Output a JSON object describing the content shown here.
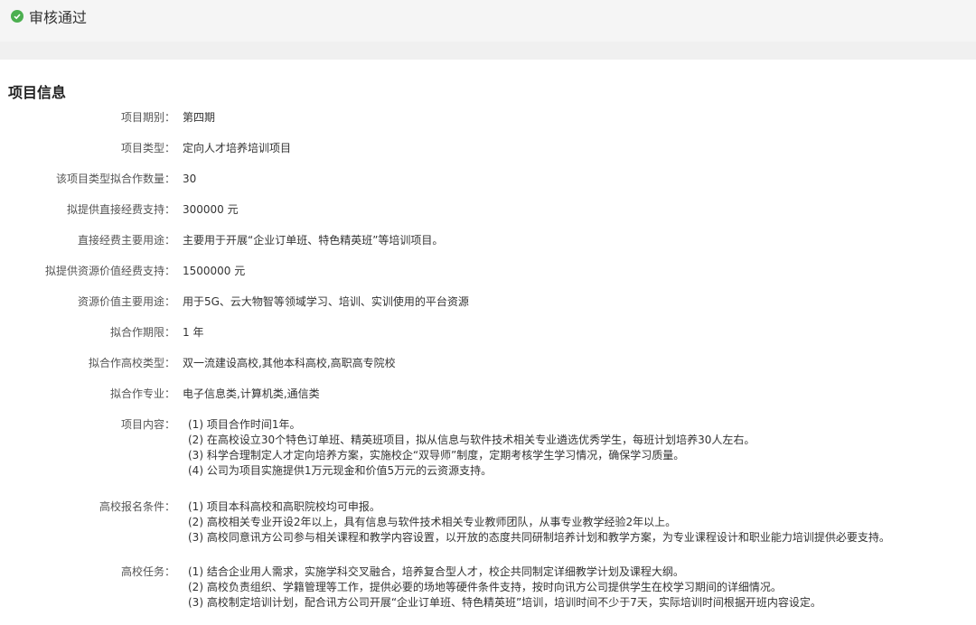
{
  "status": {
    "icon": "check-circle-icon",
    "text": "审核通过",
    "color": "#4caf50"
  },
  "section": {
    "title": "项目信息"
  },
  "fields": [
    {
      "label": "项目期别：",
      "value": "第四期"
    },
    {
      "label": "项目类型：",
      "value": "定向人才培养培训项目"
    },
    {
      "label": "该项目类型拟合作数量：",
      "value": "30"
    },
    {
      "label": "拟提供直接经费支持：",
      "value": "300000 元"
    },
    {
      "label": "直接经费主要用途：",
      "value": "主要用于开展“企业订单班、特色精英班”等培训项目。"
    },
    {
      "label": "拟提供资源价值经费支持：",
      "value": "1500000 元"
    },
    {
      "label": "资源价值主要用途：",
      "value": "用于5G、云大物智等领域学习、培训、实训使用的平台资源"
    },
    {
      "label": "拟合作期限：",
      "value": "1 年"
    },
    {
      "label": "拟合作高校类型：",
      "value": "双一流建设高校,其他本科高校,高职高专院校"
    },
    {
      "label": "拟合作专业：",
      "value": "电子信息类,计算机类,通信类"
    }
  ],
  "multi_fields": [
    {
      "label": "项目内容：",
      "lines": [
        "(1) 项目合作时间1年。",
        "(2) 在高校设立30个特色订单班、精英班项目，拟从信息与软件技术相关专业遴选优秀学生，每班计划培养30人左右。",
        "(3) 科学合理制定人才定向培养方案，实施校企“双导师”制度，定期考核学生学习情况，确保学习质量。",
        "(4) 公司为项目实施提供1万元现金和价值5万元的云资源支持。"
      ]
    },
    {
      "label": "高校报名条件：",
      "lines": [
        "(1) 项目本科高校和高职院校均可申报。",
        "(2) 高校相关专业开设2年以上，具有信息与软件技术相关专业教师团队，从事专业教学经验2年以上。",
        "(3) 高校同意讯方公司参与相关课程和教学内容设置，以开放的态度共同研制培养计划和教学方案，为专业课程设计和职业能力培训提供必要支持。"
      ]
    },
    {
      "label": "高校任务：",
      "lines": [
        "(1) 结合企业用人需求，实施学科交叉融合，培养复合型人才，校企共同制定详细教学计划及课程大纲。",
        "(2) 高校负责组织、学籍管理等工作，提供必要的场地等硬件条件支持，按时向讯方公司提供学生在校学习期间的详细情况。",
        "(3) 高校制定培训计划，配合讯方公司开展“企业订单班、特色精英班”培训，培训时间不少于7天，实际培训时间根据开班内容设定。"
      ]
    }
  ]
}
